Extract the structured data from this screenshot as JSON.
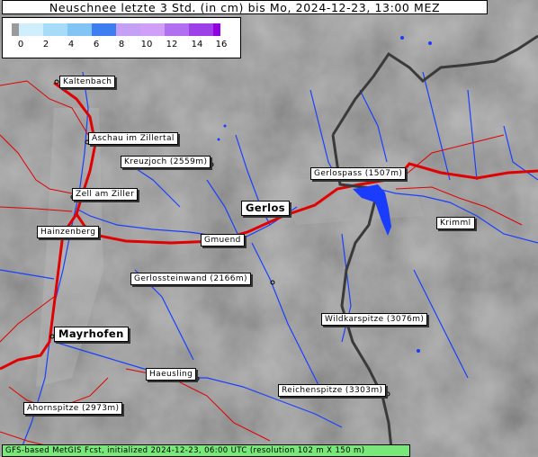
{
  "title": "Neuschnee letzte 3 Std. (in cm) bis Mo, 2024-12-23, 13:00 MEZ",
  "legend": {
    "ticks": [
      "0",
      "2",
      "4",
      "6",
      "8",
      "10",
      "12",
      "14",
      "16"
    ],
    "colors": [
      "#cfeffc",
      "#a6dcf8",
      "#82c4f4",
      "#3f7ef0",
      "#c6a0f4",
      "#d0a0f8",
      "#b070f0",
      "#9e40e8"
    ],
    "under_color": "#9a9a9a",
    "over_color": "#9000e0"
  },
  "labels": {
    "kaltenbach": "Kaltenbach",
    "aschau": "Aschau im Zillertal",
    "kreuzjoch": "Kreuzjoch (2559m)",
    "gerlospass": "Gerlospass (1507m)",
    "zell": "Zell am Ziller",
    "gerlos": "Gerlos",
    "krimml": "Krimml",
    "hainzenberg": "Hainzenberg",
    "gmuend": "Gmuend",
    "gerlossteinwand": "Gerlossteinwand (2166m)",
    "wildkarspitze": "Wildkarspitze (3076m)",
    "mayrhofen": "Mayrhofen",
    "haeusling": "Haeusling",
    "reichenspitze": "Reichenspitze (3303m)",
    "ahornspitze": "Ahornspitze (2973m)"
  },
  "colors": {
    "road": "#e00000",
    "river": "#1a40ff",
    "border": "#3a3a3a",
    "snow": "#1a3cff",
    "footer_bg": "#78e878"
  },
  "footer": "GFS-based MetGIS Fcst, initialized 2024-12-23, 06:00 UTC  (resolution 102 m X 150 m)"
}
